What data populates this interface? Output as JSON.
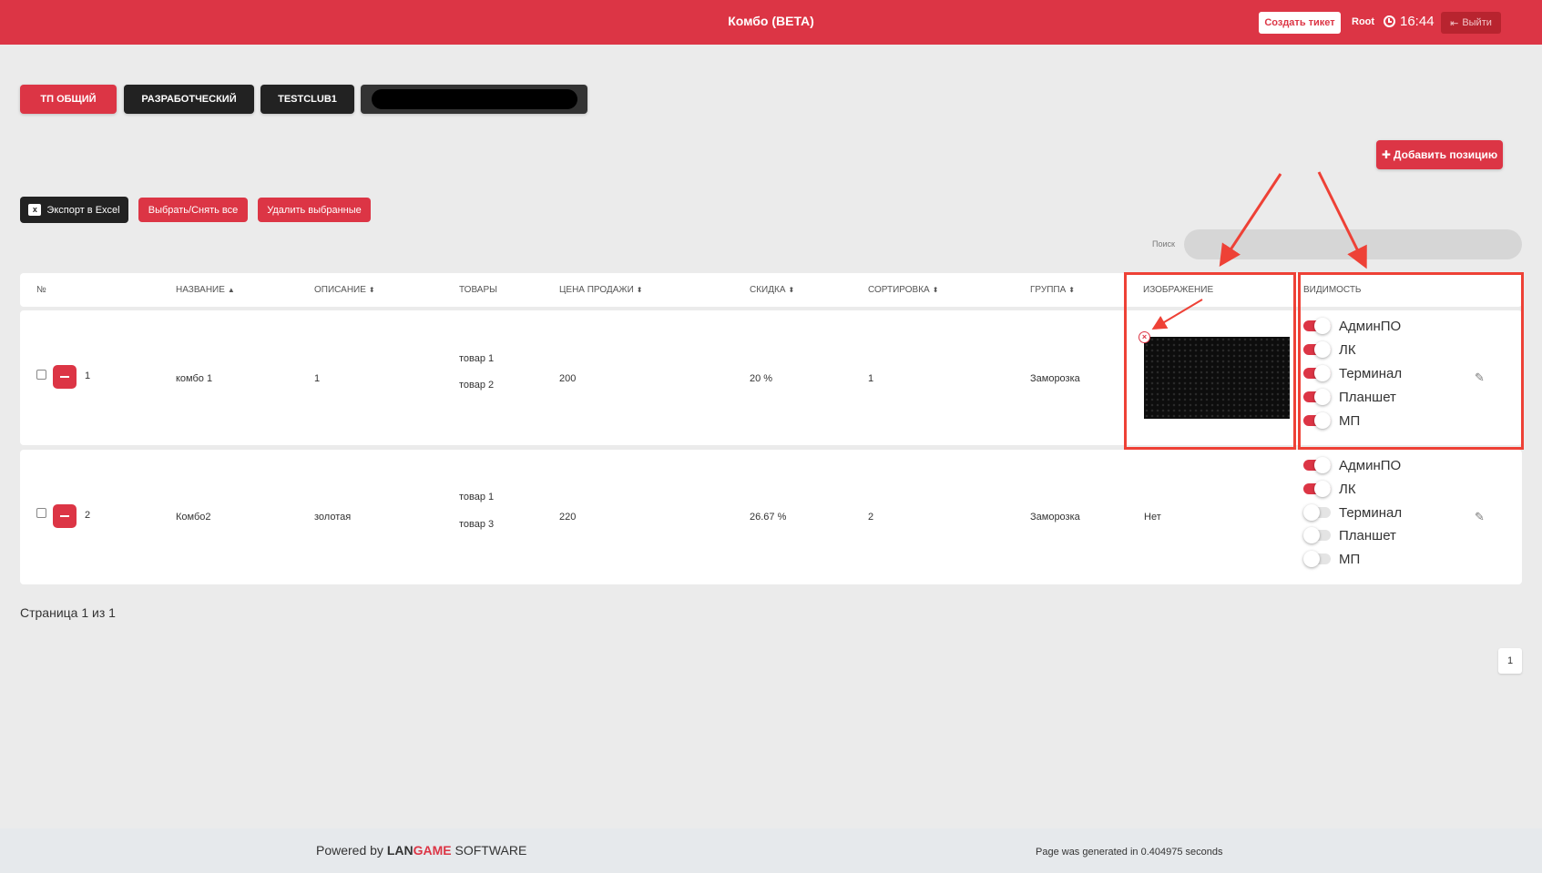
{
  "header": {
    "title": "Комбо (BETA)",
    "create_ticket": "Создать тикет",
    "user": "Root",
    "time": "16:44",
    "logout": "Выйти"
  },
  "tabs": [
    "ТП ОБЩИЙ",
    "РАЗРАБОТЧЕСКИЙ",
    "TESTCLUB1"
  ],
  "actions": {
    "add_position": "Добавить позицию",
    "export_excel": "Экспорт в Excel",
    "select_all": "Выбрать/Снять все",
    "delete_selected": "Удалить выбранные"
  },
  "search": {
    "label": "Поиск",
    "value": "",
    "placeholder": ""
  },
  "table": {
    "headers": [
      "№",
      "НАЗВАНИЕ",
      "ОПИСАНИЕ",
      "ТОВАРЫ",
      "ЦЕНА ПРОДАЖИ",
      "СКИДКА",
      "СОРТИРОВКА",
      "ГРУППА",
      "ИЗОБРАЖЕНИЕ",
      "ВИДИМОСТЬ"
    ],
    "sort_up": "▲",
    "sort_both": "⬍",
    "rows": [
      {
        "num": "1",
        "name": "комбо 1",
        "description": "1",
        "goods": [
          "товар 1",
          "товар 2"
        ],
        "price": "200",
        "discount": "20 %",
        "sort": "1",
        "group": "Заморозка",
        "image": "",
        "visibility": [
          {
            "label": "АдминПО",
            "on": true
          },
          {
            "label": "ЛК",
            "on": true
          },
          {
            "label": "Терминал",
            "on": true
          },
          {
            "label": "Планшет",
            "on": true
          },
          {
            "label": "МП",
            "on": true
          }
        ]
      },
      {
        "num": "2",
        "name": "Комбо2",
        "description": "золотая",
        "goods": [
          "товар 1",
          "товар 3"
        ],
        "price": "220",
        "discount": "26.67 %",
        "sort": "2",
        "group": "Заморозка",
        "image": "Нет",
        "visibility": [
          {
            "label": "АдминПО",
            "on": true
          },
          {
            "label": "ЛК",
            "on": true
          },
          {
            "label": "Терминал",
            "on": false
          },
          {
            "label": "Планшет",
            "on": false
          },
          {
            "label": "МП",
            "on": false
          }
        ]
      }
    ]
  },
  "pagination": {
    "info": "Страница 1 из 1",
    "current": "1"
  },
  "footer": {
    "powered_prefix": "Powered by ",
    "brand_a": "LAN",
    "brand_b": "GAME",
    "brand_c": " SOFTWARE",
    "generated": "Page was generated in 0.404975 seconds"
  },
  "colors": {
    "accent": "#dc3545",
    "annotation": "#ee4136",
    "dark": "#222222"
  }
}
